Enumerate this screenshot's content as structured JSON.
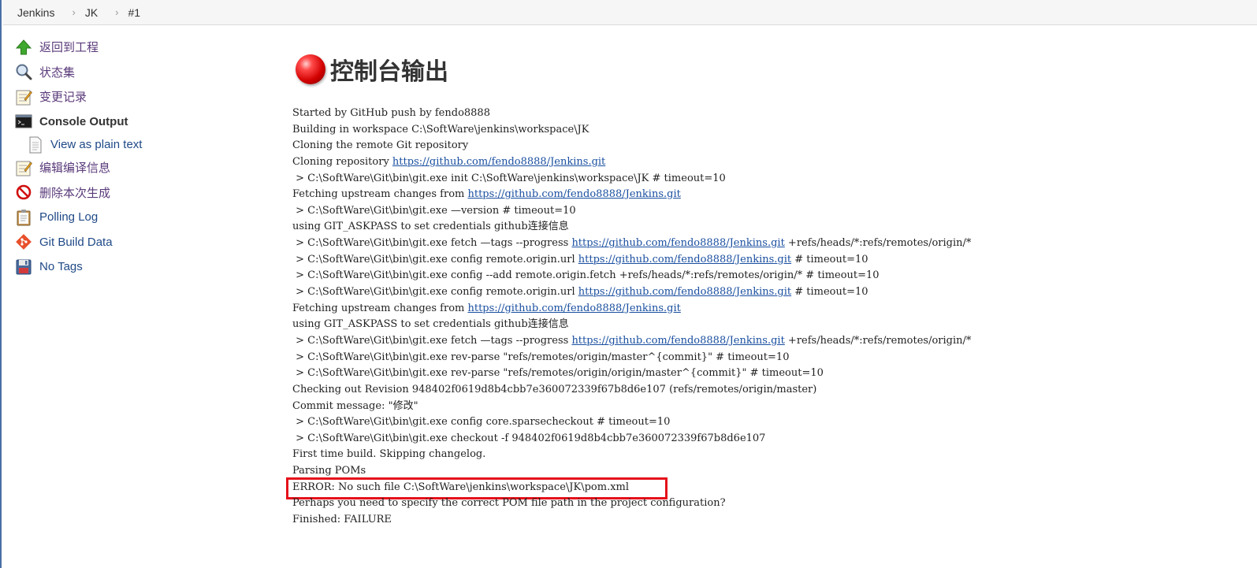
{
  "breadcrumb": [
    "Jenkins",
    "JK",
    "#1"
  ],
  "breadcrumb_separator": "›",
  "sidebar": {
    "items": [
      {
        "label": "返回到工程",
        "icon": "up-arrow-icon"
      },
      {
        "label": "状态集",
        "icon": "magnifier-icon"
      },
      {
        "label": "变更记录",
        "icon": "notepad-icon"
      },
      {
        "label": "Console Output",
        "icon": "terminal-icon"
      },
      {
        "label": "View as plain text",
        "icon": "document-icon"
      },
      {
        "label": "编辑编译信息",
        "icon": "notepad-edit-icon"
      },
      {
        "label": "删除本次生成",
        "icon": "no-entry-icon"
      },
      {
        "label": "Polling Log",
        "icon": "clipboard-icon"
      },
      {
        "label": "Git Build Data",
        "icon": "git-icon"
      },
      {
        "label": "No Tags",
        "icon": "floppy-icon"
      }
    ]
  },
  "main": {
    "title": "控制台输出",
    "status_color": "#d20000"
  },
  "console": [
    {
      "pre": "Started by GitHub push by fendo8888"
    },
    {
      "pre": "Building in workspace C:\\SoftWare\\jenkins\\workspace\\JK"
    },
    {
      "pre": "Cloning the remote Git repository"
    },
    {
      "pre": "Cloning repository ",
      "link": "https://github.com/fendo8888/Jenkins.git"
    },
    {
      "pre": " > C:\\SoftWare\\Git\\bin\\git.exe init C:\\SoftWare\\jenkins\\workspace\\JK # timeout=10"
    },
    {
      "pre": "Fetching upstream changes from ",
      "link": "https://github.com/fendo8888/Jenkins.git"
    },
    {
      "pre": " > C:\\SoftWare\\Git\\bin\\git.exe —version # timeout=10"
    },
    {
      "pre": "using GIT_ASKPASS to set credentials github连接信息"
    },
    {
      "pre": " > C:\\SoftWare\\Git\\bin\\git.exe fetch —tags --progress ",
      "link": "https://github.com/fendo8888/Jenkins.git",
      "post": " +refs/heads/*:refs/remotes/origin/*"
    },
    {
      "pre": " > C:\\SoftWare\\Git\\bin\\git.exe config remote.origin.url ",
      "link": "https://github.com/fendo8888/Jenkins.git",
      "post": " # timeout=10"
    },
    {
      "pre": " > C:\\SoftWare\\Git\\bin\\git.exe config --add remote.origin.fetch +refs/heads/*:refs/remotes/origin/* # timeout=10"
    },
    {
      "pre": " > C:\\SoftWare\\Git\\bin\\git.exe config remote.origin.url ",
      "link": "https://github.com/fendo8888/Jenkins.git",
      "post": " # timeout=10"
    },
    {
      "pre": "Fetching upstream changes from ",
      "link": "https://github.com/fendo8888/Jenkins.git"
    },
    {
      "pre": "using GIT_ASKPASS to set credentials github连接信息"
    },
    {
      "pre": " > C:\\SoftWare\\Git\\bin\\git.exe fetch —tags --progress ",
      "link": "https://github.com/fendo8888/Jenkins.git",
      "post": " +refs/heads/*:refs/remotes/origin/*"
    },
    {
      "pre": " > C:\\SoftWare\\Git\\bin\\git.exe rev-parse \"refs/remotes/origin/master^{commit}\" # timeout=10"
    },
    {
      "pre": " > C:\\SoftWare\\Git\\bin\\git.exe rev-parse \"refs/remotes/origin/origin/master^{commit}\" # timeout=10"
    },
    {
      "pre": "Checking out Revision 948402f0619d8b4cbb7e360072339f67b8d6e107 (refs/remotes/origin/master)"
    },
    {
      "pre": "Commit message: \"修改\""
    },
    {
      "pre": " > C:\\SoftWare\\Git\\bin\\git.exe config core.sparsecheckout # timeout=10"
    },
    {
      "pre": " > C:\\SoftWare\\Git\\bin\\git.exe checkout -f 948402f0619d8b4cbb7e360072339f67b8d6e107"
    },
    {
      "pre": "First time build. Skipping changelog."
    },
    {
      "pre": "Parsing POMs"
    },
    {
      "pre": "ERROR: No such file C:\\SoftWare\\jenkins\\workspace\\JK\\pom.xml",
      "highlight": true
    },
    {
      "pre": "Perhaps you need to specify the correct POM file path in the project configuration?"
    },
    {
      "pre": "Finished: FAILURE"
    }
  ],
  "colors": {
    "link": "#1a4fa0",
    "highlight_border": "#e5101a"
  }
}
